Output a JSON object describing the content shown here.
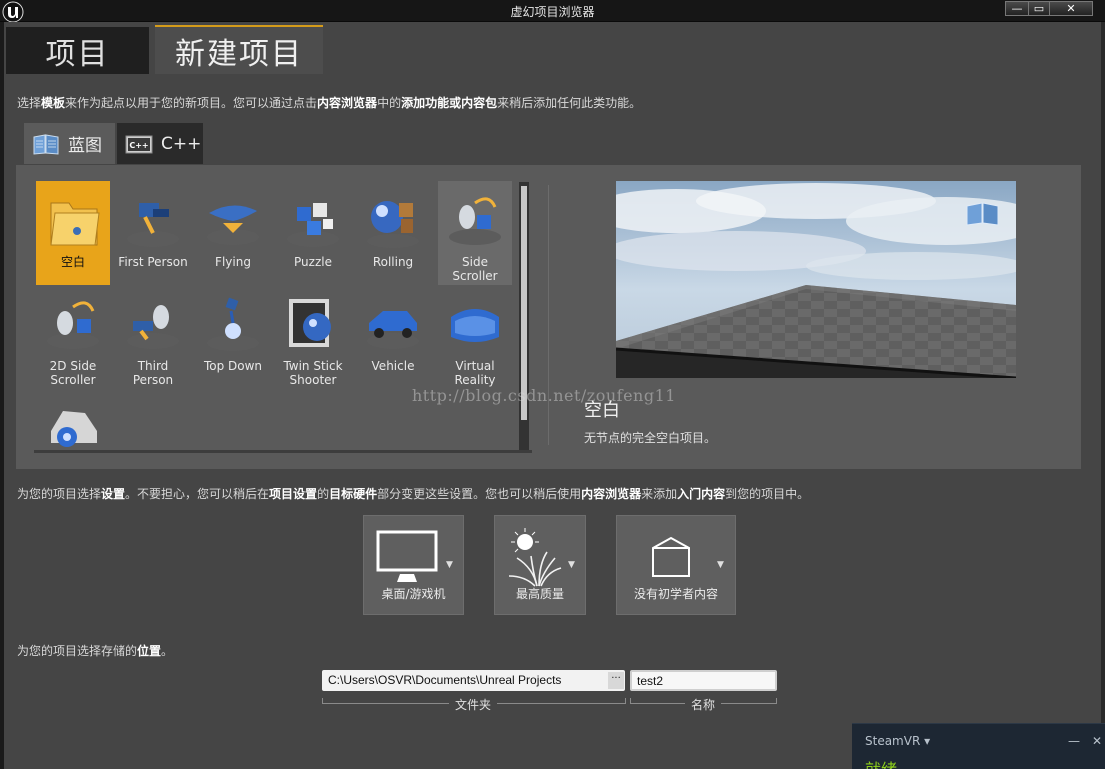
{
  "window": {
    "title": "虚幻项目浏览器",
    "minimize_label": "—",
    "maximize_label": "▭",
    "close_label": "✕"
  },
  "tabs": {
    "projects": "项目",
    "new_project": "新建项目"
  },
  "intro": {
    "p1": "选择",
    "b1": "模板",
    "p2": "来作为起点以用于您的新项目。您可以通过点击",
    "b2": "内容浏览器",
    "p3": "中的",
    "b3": "添加功能或内容包",
    "p4": "来稍后添加任何此类功能。"
  },
  "language_tabs": {
    "blueprint": "蓝图",
    "cpp": "C++",
    "cpp_icon_text": "C++"
  },
  "templates": [
    {
      "label": "空白",
      "icon": "folder-icon"
    },
    {
      "label": "First Person",
      "icon": "first-person-icon"
    },
    {
      "label": "Flying",
      "icon": "flying-icon"
    },
    {
      "label": "Puzzle",
      "icon": "puzzle-icon"
    },
    {
      "label": "Rolling",
      "icon": "rolling-icon"
    },
    {
      "label": "Side Scroller",
      "icon": "side-scroller-icon"
    },
    {
      "label": "2D Side Scroller",
      "icon": "2d-side-scroller-icon"
    },
    {
      "label": "Third Person",
      "icon": "third-person-icon"
    },
    {
      "label": "Top Down",
      "icon": "top-down-icon"
    },
    {
      "label": "Twin Stick Shooter",
      "icon": "twin-stick-icon"
    },
    {
      "label": "Vehicle",
      "icon": "vehicle-icon"
    },
    {
      "label": "Virtual Reality",
      "icon": "vr-headset-icon"
    },
    {
      "label": "",
      "icon": "vehicle-advanced-icon"
    }
  ],
  "selected_template": {
    "title": "空白",
    "description": "无节点的完全空白项目。"
  },
  "watermark": "http://blog.csdn.net/zoufeng11",
  "settings_intro": {
    "p1": "为您的项目选择",
    "b1": "设置",
    "p2": "。不要担心，您可以稍后在",
    "b2": "项目设置",
    "p3": "的",
    "b3": "目标硬件",
    "p4": "部分变更这些设置。您也可以稍后使用",
    "b4": "内容浏览器",
    "p5": "来添加",
    "b5": "入门内容",
    "p6": "到您的项目中。"
  },
  "settings": {
    "platform": "桌面/游戏机",
    "quality": "最高质量",
    "starter_content": "没有初学者内容"
  },
  "location_intro": {
    "p1": "为您的项目选择存储的",
    "b1": "位置",
    "p2": "。"
  },
  "location": {
    "path": "C:\\Users\\OSVR\\Documents\\Unreal Projects",
    "browse_label": "···",
    "path_label": "文件夹",
    "name": "test2",
    "name_label": "名称"
  },
  "steamvr": {
    "name": "SteamVR ▾",
    "minimize": "—",
    "close": "✕",
    "status": "就绪"
  },
  "colors": {
    "accent": "#e8a41a",
    "panel": "#5a5a5a",
    "background": "#454545",
    "steam_status": "#8fd11c"
  }
}
